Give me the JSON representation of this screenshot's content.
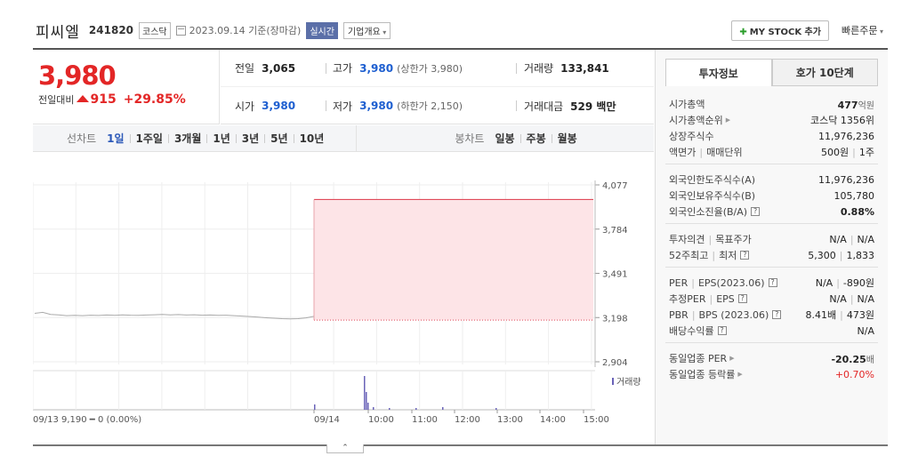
{
  "header": {
    "name": "피씨엘",
    "code": "241820",
    "market": "코스닥",
    "date": "2023.09.14 기준(장마감)",
    "realtime": "실시간",
    "company_info": "기업개요",
    "mystock": "MY STOCK 추가",
    "quick_order": "빠른주문"
  },
  "price": {
    "current": "3,980",
    "change_label": "전일대비",
    "change": "915",
    "pct": "+29.85%"
  },
  "quotes": {
    "prev_label": "전일",
    "prev": "3,065",
    "high_label": "고가",
    "high": "3,980",
    "high_extra": "(상한가 3,980)",
    "volume_label": "거래량",
    "volume": "133,841",
    "open_label": "시가",
    "open": "3,980",
    "low_label": "저가",
    "low": "3,980",
    "low_extra": "(하한가 2,150)",
    "amount_label": "거래대금",
    "amount": "529 백만"
  },
  "tabs": {
    "line_label": "선차트",
    "line": [
      "1일",
      "1주일",
      "3개월",
      "1년",
      "3년",
      "5년",
      "10년"
    ],
    "candle_label": "봉차트",
    "candle": [
      "일봉",
      "주봉",
      "월봉"
    ]
  },
  "chart_data": {
    "type": "line",
    "yticks": [
      "4,077",
      "3,784",
      "3,491",
      "3,198",
      "2,904"
    ],
    "ylim": [
      2904,
      4077
    ],
    "xticks": [
      "09/14",
      "10:00",
      "11:00",
      "12:00",
      "13:00",
      "14:00",
      "15:00"
    ],
    "left_label": "09/13  9,190 ━ 0 (0.00%)",
    "volume_label": "거래량",
    "prev_close": 3065,
    "current": 3980,
    "prev_day_series": [
      3225,
      3232,
      3218,
      3215,
      3210,
      3212,
      3210,
      3213,
      3211,
      3214,
      3212,
      3215,
      3213,
      3212,
      3214,
      3216,
      3218,
      3215,
      3217,
      3214,
      3216,
      3213,
      3214,
      3212,
      3213,
      3210,
      3207,
      3204,
      3200,
      3196,
      3193,
      3190,
      3188,
      3190,
      3195,
      3205
    ]
  },
  "info_tabs": [
    "투자정보",
    "호가 10단계"
  ],
  "info": {
    "market_cap_label": "시가총액",
    "market_cap": "477",
    "market_cap_unit": "억원",
    "rank_label": "시가총액순위",
    "rank": "코스닥 1356위",
    "shares_label": "상장주식수",
    "shares": "11,976,236",
    "face_label": "액면가",
    "unit_label": "매매단위",
    "face": "500원",
    "unit": "1주",
    "foreign_limit_label": "외국인한도주식수(A)",
    "foreign_limit": "11,976,236",
    "foreign_hold_label": "외국인보유주식수(B)",
    "foreign_hold": "105,780",
    "foreign_rate_label": "외국인소진율(B/A)",
    "foreign_rate": "0.88%",
    "opinion_label": "투자의견",
    "target_label": "목표주가",
    "opinion": "N/A",
    "target": "N/A",
    "w52_high_label": "52주최고",
    "w52_low_label": "최저",
    "w52_high": "5,300",
    "w52_low": "1,833",
    "per_label": "PER",
    "eps_label": "EPS(2023.06)",
    "per": "N/A",
    "eps": "-890원",
    "est_per_label": "추정PER",
    "est_eps_label": "EPS",
    "est_per": "N/A",
    "est_eps": "N/A",
    "pbr_label": "PBR",
    "bps_label": "BPS (2023.06)",
    "pbr": "8.41배",
    "bps": "473원",
    "div_label": "배당수익률",
    "div": "N/A",
    "ind_per_label": "동일업종 PER",
    "ind_per": "-20.25",
    "ind_per_unit": "배",
    "ind_rate_label": "동일업종 등락률",
    "ind_rate": "+0.70%"
  }
}
